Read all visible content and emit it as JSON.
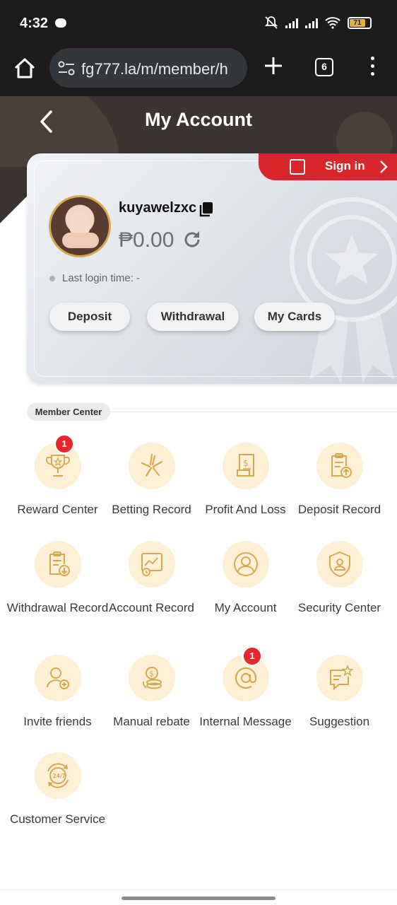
{
  "status_bar": {
    "time": "4:32",
    "battery": "71"
  },
  "browser": {
    "url": "fg777.la/m/member/h",
    "tab_count": "6"
  },
  "header": {
    "title": "My Account"
  },
  "profile": {
    "sign_in_label": "Sign in",
    "username": "kuyawelzxc",
    "balance": "₱0.00",
    "last_login": "Last login time: -",
    "buttons": {
      "deposit": "Deposit",
      "withdrawal": "Withdrawal",
      "my_cards": "My Cards"
    }
  },
  "member_center": {
    "title": "Member Center",
    "items": [
      {
        "label": "Reward Center",
        "icon": "trophy-icon",
        "badge": "1"
      },
      {
        "label": "Betting Record",
        "icon": "sparkle-icon"
      },
      {
        "label": "Profit And Loss",
        "icon": "receipt-icon"
      },
      {
        "label": "Deposit Record",
        "icon": "clipboard-upload-icon"
      },
      {
        "label": "Withdrawal Record",
        "icon": "clipboard-download-icon"
      },
      {
        "label": "Account Record",
        "icon": "chart-screen-icon"
      },
      {
        "label": "My Account",
        "icon": "user-circle-icon"
      },
      {
        "label": "Security Center",
        "icon": "shield-user-icon"
      },
      {
        "label": "Invite friends",
        "icon": "user-add-icon"
      },
      {
        "label": "Manual rebate",
        "icon": "coins-icon"
      },
      {
        "label": "Internal Message",
        "icon": "at-sign-icon",
        "badge": "1"
      },
      {
        "label": "Suggestion",
        "icon": "chat-star-icon"
      },
      {
        "label": "Customer Service",
        "icon": "support-24-7-icon"
      }
    ]
  },
  "colors": {
    "accent": "#d9262c",
    "icon_gold": "#d6a951",
    "icon_bg": "#fdf0d5",
    "header_bg": "#3b3430"
  }
}
